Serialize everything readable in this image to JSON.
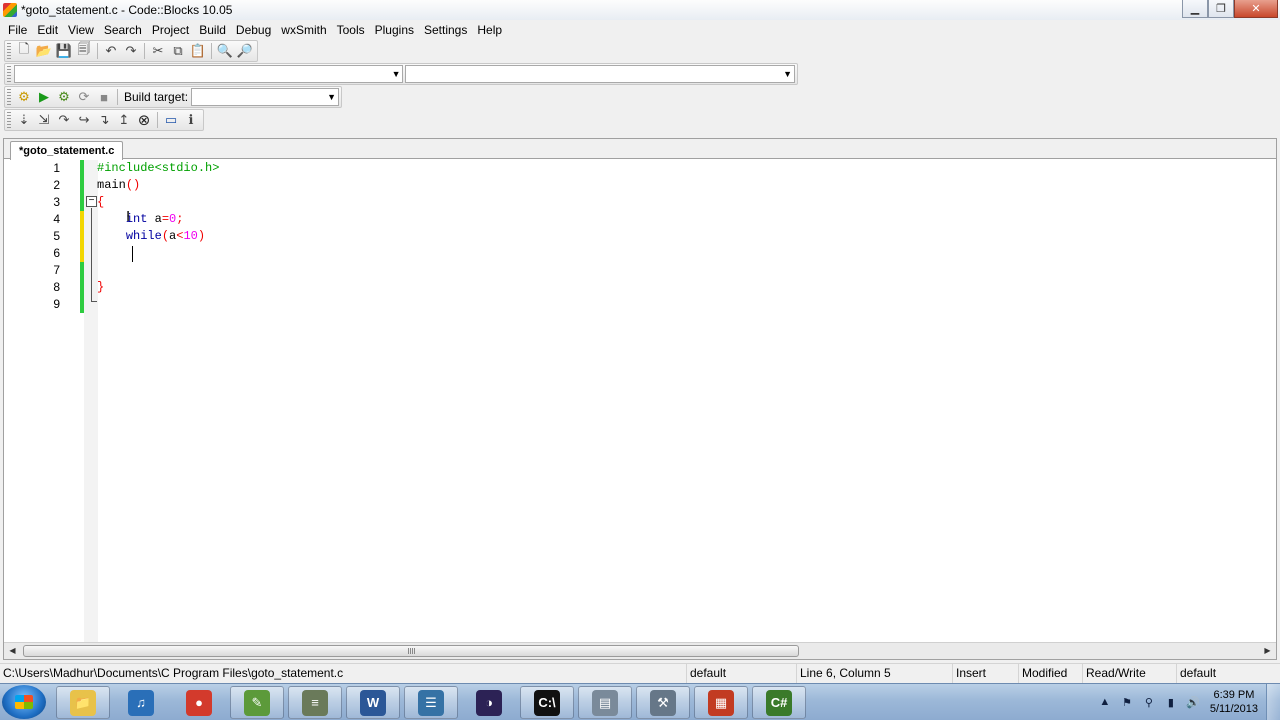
{
  "window": {
    "title": "*goto_statement.c - Code::Blocks 10.05"
  },
  "menu": [
    "File",
    "Edit",
    "View",
    "Search",
    "Project",
    "Build",
    "Debug",
    "wxSmith",
    "Tools",
    "Plugins",
    "Settings",
    "Help"
  ],
  "build": {
    "target_label": "Build target:",
    "target_value": ""
  },
  "scope": {
    "left_value": "",
    "right_value": ""
  },
  "editor": {
    "tab_label": "*goto_statement.c",
    "lines": [
      {
        "num": "1",
        "tokens": [
          {
            "t": "#include<stdio.h>",
            "c": "c-pre"
          }
        ]
      },
      {
        "num": "2",
        "tokens": [
          {
            "t": "main",
            "c": ""
          },
          {
            "t": "()",
            "c": "c-op"
          }
        ]
      },
      {
        "num": "3",
        "tokens": [
          {
            "t": "{",
            "c": "c-brace"
          }
        ]
      },
      {
        "num": "4",
        "tokens": [
          {
            "t": "    ",
            "c": ""
          },
          {
            "t": "int",
            "c": "c-kw"
          },
          {
            "t": " a",
            "c": ""
          },
          {
            "t": "=",
            "c": "c-op"
          },
          {
            "t": "0",
            "c": "c-num"
          },
          {
            "t": ";",
            "c": "c-op"
          }
        ]
      },
      {
        "num": "5",
        "tokens": [
          {
            "t": "    ",
            "c": ""
          },
          {
            "t": "while",
            "c": "c-kw"
          },
          {
            "t": "(",
            "c": "c-op"
          },
          {
            "t": "a",
            "c": ""
          },
          {
            "t": "<",
            "c": "c-op"
          },
          {
            "t": "10",
            "c": "c-num"
          },
          {
            "t": ")",
            "c": "c-op"
          }
        ]
      },
      {
        "num": "6",
        "tokens": []
      },
      {
        "num": "7",
        "tokens": []
      },
      {
        "num": "8",
        "tokens": [
          {
            "t": "}",
            "c": "c-brace"
          }
        ]
      },
      {
        "num": "9",
        "tokens": []
      }
    ],
    "change_markers": [
      "green",
      "green",
      "green",
      "yellow",
      "yellow",
      "yellow",
      "green",
      "green",
      "green"
    ]
  },
  "status": {
    "file_path": "C:\\Users\\Madhur\\Documents\\C Program Files\\goto_statement.c",
    "encoding": "default",
    "position": "Line 6, Column 5",
    "mode": "Insert",
    "modified": "Modified",
    "access": "Read/Write",
    "lang": "default"
  },
  "taskbar": {
    "clock_time": "6:39 PM",
    "clock_date": "5/11/2013",
    "apps": [
      {
        "name": "explorer-icon",
        "glyph": "📁",
        "bg": "#e8c24a"
      },
      {
        "name": "itunes-icon",
        "glyph": "♫",
        "bg": "#2a6fb8"
      },
      {
        "name": "chrome-icon",
        "glyph": "●",
        "bg": "#d33a2c"
      },
      {
        "name": "notepad-icon",
        "glyph": "✎",
        "bg": "#5c9a3a"
      },
      {
        "name": "database-icon",
        "glyph": "≡",
        "bg": "#6a7a5a"
      },
      {
        "name": "word-icon",
        "glyph": "W",
        "bg": "#2b5797"
      },
      {
        "name": "python-icon",
        "glyph": "☰",
        "bg": "#3572a5"
      },
      {
        "name": "eclipse-icon",
        "glyph": "◑",
        "bg": "#2c2255"
      },
      {
        "name": "cmd-icon",
        "glyph": "C:\\",
        "bg": "#111111"
      },
      {
        "name": "sql-icon",
        "glyph": "▤",
        "bg": "#7a8a9a"
      },
      {
        "name": "tools-icon",
        "glyph": "⚒",
        "bg": "#667788"
      },
      {
        "name": "codeblocks-icon",
        "glyph": "▦",
        "bg": "#c23b22"
      },
      {
        "name": "csharp-icon",
        "glyph": "C#",
        "bg": "#3a7a2a"
      }
    ]
  }
}
